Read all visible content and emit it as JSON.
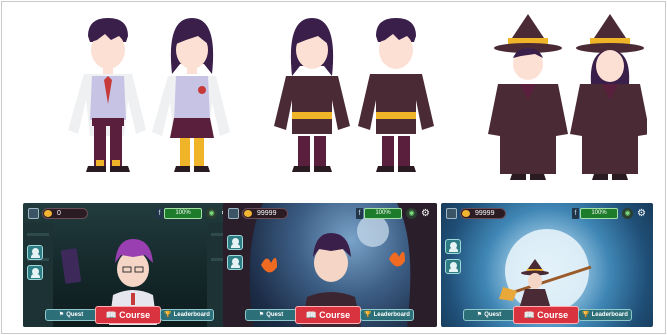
{
  "colors": {
    "hair": "#3a1f4a",
    "skin": "#fde0d4",
    "vest": "#c7c3e4",
    "shirt": "#eef0f2",
    "trousers": "#5a1f3c",
    "tie": "#c63a3a",
    "robe": "#4a2a35",
    "belt": "#f0b428",
    "hat": "#4a2a35",
    "course_button": "#d9333f",
    "teal_button": "#2c6f78",
    "power_bar": "#1d7c2b",
    "coin": "#f2b531"
  },
  "characters": [
    {
      "outfit": "school-uniform",
      "gender": "boy"
    },
    {
      "outfit": "school-uniform",
      "gender": "girl"
    },
    {
      "outfit": "robe-with-belt",
      "gender": "girl"
    },
    {
      "outfit": "robe-with-belt",
      "gender": "boy"
    },
    {
      "outfit": "witch-hat-robe",
      "gender": "boy"
    },
    {
      "outfit": "witch-hat-robe",
      "gender": "girl"
    }
  ],
  "screens": [
    {
      "scene": "library",
      "coins": "0",
      "power_prefix": "f",
      "power": "100%",
      "quest_label": "Quest",
      "course_label": "Course",
      "leaderboard_label": "Leaderboard",
      "icons": [
        "avatar-icon",
        "coin-icon",
        "wifi-icon",
        "gear-icon",
        "profile-icon",
        "team-icon",
        "book-icon"
      ]
    },
    {
      "scene": "moonlit-cave",
      "coins": "99999",
      "power_prefix": "f",
      "power": "100%",
      "quest_label": "Quest",
      "course_label": "Course",
      "leaderboard_label": "Leaderboard",
      "icons": [
        "avatar-icon",
        "coin-icon",
        "wifi-icon",
        "gear-icon",
        "profile-icon",
        "team-icon",
        "fire-icon"
      ]
    },
    {
      "scene": "full-moon-broom",
      "coins": "99999",
      "power_prefix": "f",
      "power": "100%",
      "quest_label": "Quest",
      "course_label": "Course",
      "leaderboard_label": "Leaderboard",
      "icons": [
        "avatar-icon",
        "coin-icon",
        "wifi-icon",
        "gear-icon",
        "profile-icon",
        "team-icon",
        "broom-icon"
      ]
    }
  ]
}
